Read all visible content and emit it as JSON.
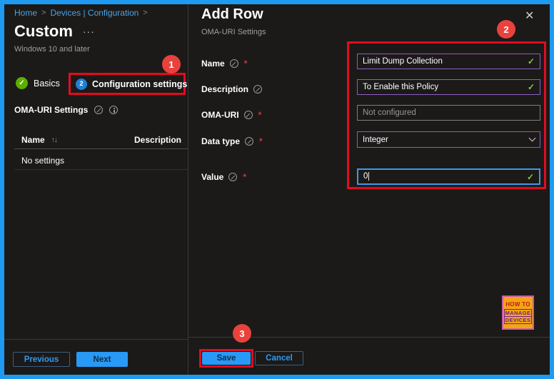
{
  "icons": {
    "check": "✓",
    "close": "✕",
    "sort": "↑↓",
    "ellipsis": "···",
    "separator": ">"
  },
  "annotations": {
    "step1": "1",
    "step2": "2",
    "step3": "3"
  },
  "left_panel": {
    "breadcrumb": {
      "items": [
        "Home",
        "Devices | Configuration"
      ],
      "separator": ">"
    },
    "title": "Custom",
    "platform": "Windows 10 and later",
    "tabs": {
      "basics": "Basics",
      "configuration": "Configuration settings",
      "configuration_badge": "2"
    },
    "section": {
      "label": "OMA-URI Settings"
    },
    "table": {
      "col_name": "Name",
      "col_description": "Description",
      "empty": "No settings"
    },
    "footer": {
      "previous": "Previous",
      "next": "Next"
    }
  },
  "add_row_panel": {
    "title": "Add Row",
    "subtitle": "OMA-URI Settings",
    "fields": [
      {
        "label": "Name",
        "required": "*",
        "value": "Limit Dump Collection"
      },
      {
        "label": "Description",
        "required": "",
        "value": "To Enable this Policy"
      },
      {
        "label": "OMA-URI",
        "required": "*",
        "placeholder": "Not configured"
      },
      {
        "label": "Data type",
        "required": "*",
        "value": "Integer"
      },
      {
        "label": "Value",
        "required": "*",
        "value": "0"
      }
    ],
    "footer": {
      "save": "Save",
      "cancel": "Cancel"
    }
  },
  "logo": {
    "line1": "HOW TO",
    "line2": "MANAGE",
    "line3": "DEVICES"
  },
  "colors": {
    "frame_border": "#1E9AF0",
    "background": "#1B1A19",
    "annotation_red": "#E30B1E",
    "field_purple": "#8F5DC2",
    "field_focus_blue": "#4097E8",
    "valid_green": "#8AC34E",
    "primary_button_blue": "#2899F5",
    "link_blue": "#4FA1E0",
    "badge_green": "#5CAE00",
    "badge_blue": "#1F7FD4"
  }
}
